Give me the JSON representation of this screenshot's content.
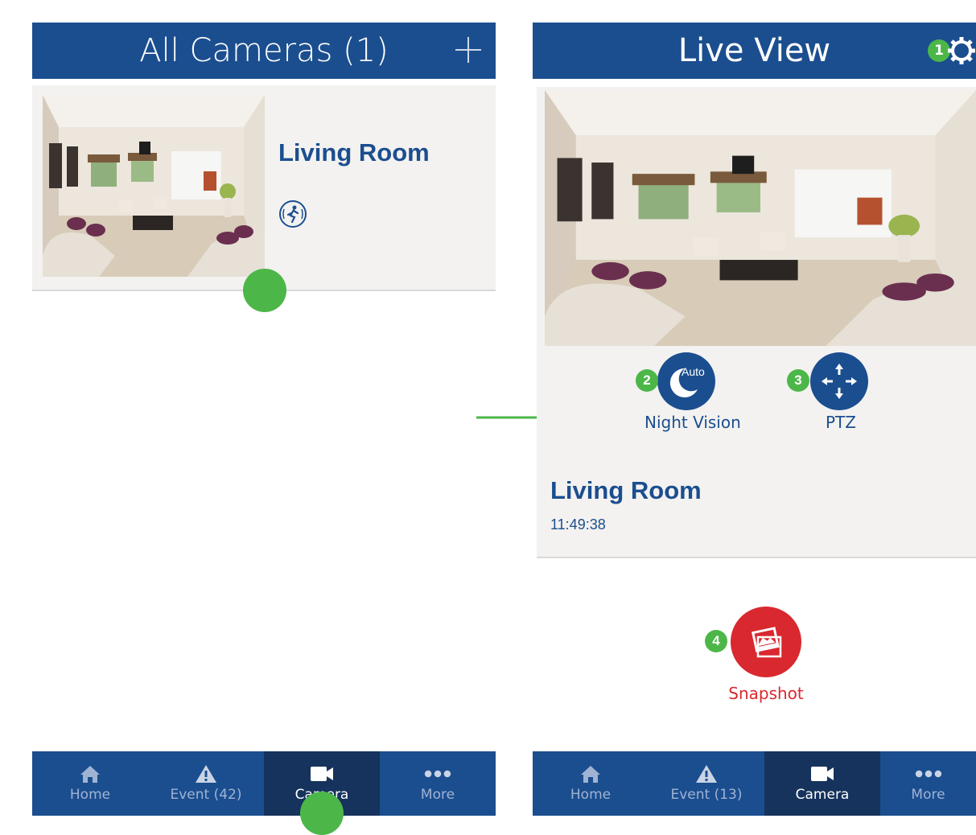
{
  "left_screen": {
    "header": {
      "title": "All Cameras (1)"
    },
    "camera": {
      "name": "Living Room"
    },
    "tabbar": [
      {
        "label": "Home",
        "icon": "home-icon",
        "active": false
      },
      {
        "label": "Event (42)",
        "icon": "warning-icon",
        "active": false
      },
      {
        "label": "Camera",
        "icon": "camera-icon",
        "active": true
      },
      {
        "label": "More",
        "icon": "more-icon",
        "active": false
      }
    ]
  },
  "right_screen": {
    "header": {
      "title": "Live View"
    },
    "controls": {
      "night_vision": {
        "label": "Night Vision",
        "badge_text": "Auto"
      },
      "ptz": {
        "label": "PTZ"
      }
    },
    "camera": {
      "name": "Living Room",
      "time": "11:49:38"
    },
    "snapshot": {
      "label": "Snapshot"
    },
    "tabbar": [
      {
        "label": "Home",
        "icon": "home-icon",
        "active": false
      },
      {
        "label": "Event (13)",
        "icon": "warning-icon",
        "active": false
      },
      {
        "label": "Camera",
        "icon": "camera-icon",
        "active": true
      },
      {
        "label": "More",
        "icon": "more-icon",
        "active": false
      }
    ]
  },
  "annotations": [
    "1",
    "2",
    "3",
    "4"
  ],
  "colors": {
    "brand_blue": "#1b4e8f",
    "active_tab": "#15335c",
    "marker_green": "#4cb748",
    "snapshot_red": "#d9282f"
  }
}
